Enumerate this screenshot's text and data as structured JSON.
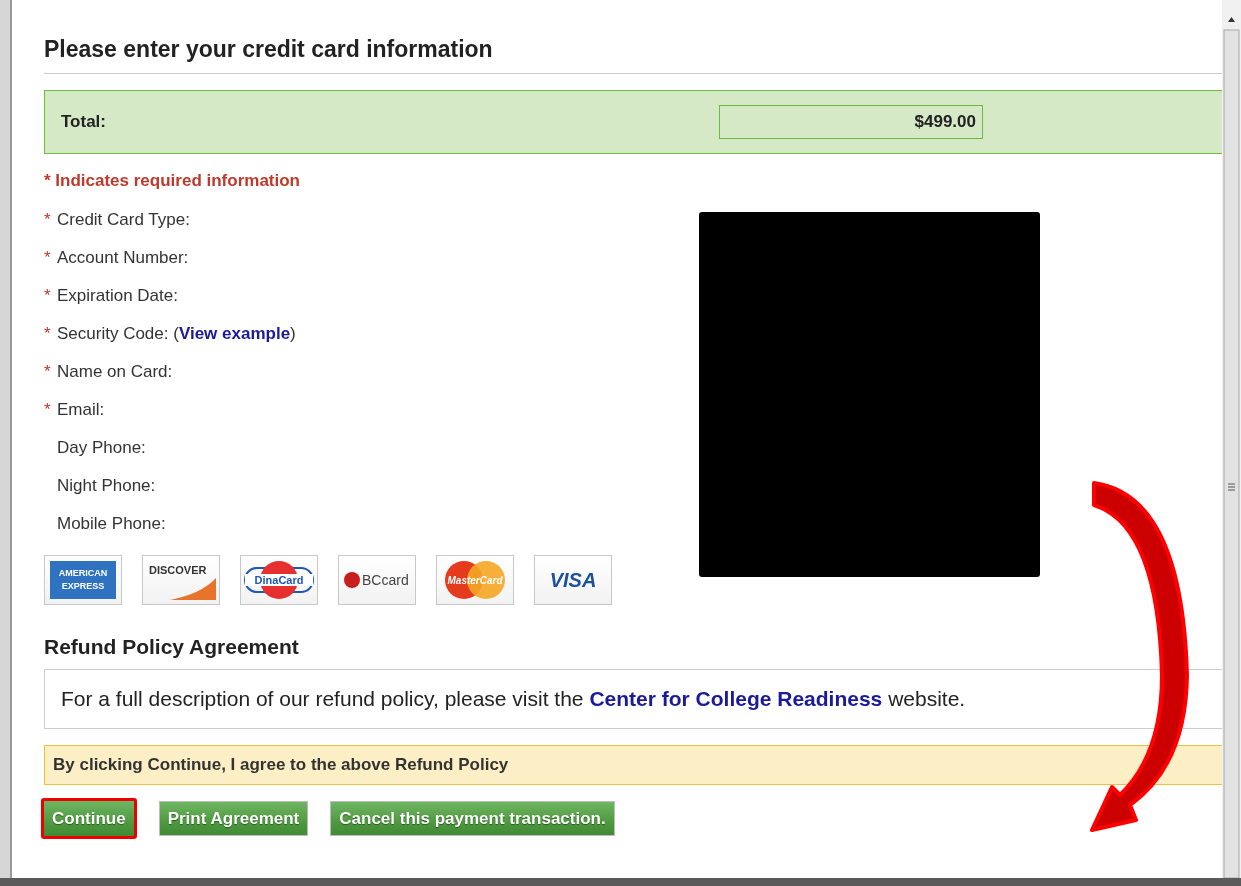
{
  "title": "Please enter your credit card information",
  "total": {
    "label": "Total:",
    "value": "$499.00"
  },
  "required_note": "* Indicates required information",
  "fields": [
    {
      "label": "Credit Card Type:",
      "required": true
    },
    {
      "label": "Account Number:",
      "required": true
    },
    {
      "label": "Expiration Date:",
      "required": true
    },
    {
      "label": "Security Code: (",
      "link": "View example",
      "suffix": ")",
      "required": true
    },
    {
      "label": "Name on Card:",
      "required": true
    },
    {
      "label": "Email:",
      "required": true
    },
    {
      "label": "Day Phone:",
      "required": false
    },
    {
      "label": "Night Phone:",
      "required": false
    },
    {
      "label": "Mobile Phone:",
      "required": false
    }
  ],
  "required_mark": "*",
  "cards": [
    {
      "kind": "amex",
      "text": "AMERICAN EXPRESS"
    },
    {
      "kind": "discover",
      "text": "DISCOVER"
    },
    {
      "kind": "dinacard",
      "text": "DinaCard"
    },
    {
      "kind": "bccard",
      "text": "BCcard"
    },
    {
      "kind": "mastercard",
      "text": "MasterCard"
    },
    {
      "kind": "visa",
      "text": "VISA"
    }
  ],
  "refund": {
    "heading": "Refund Policy Agreement",
    "text_before": "For a full description of our refund policy, please visit the ",
    "link": "Center for College Readiness",
    "text_after": " website."
  },
  "agreement_note": "By clicking Continue, I agree to the above Refund Policy",
  "buttons": [
    {
      "label": "Continue",
      "highlighted": true
    },
    {
      "label": "Print Agreement",
      "highlighted": false
    },
    {
      "label": "Cancel this payment transaction.",
      "highlighted": false
    }
  ]
}
